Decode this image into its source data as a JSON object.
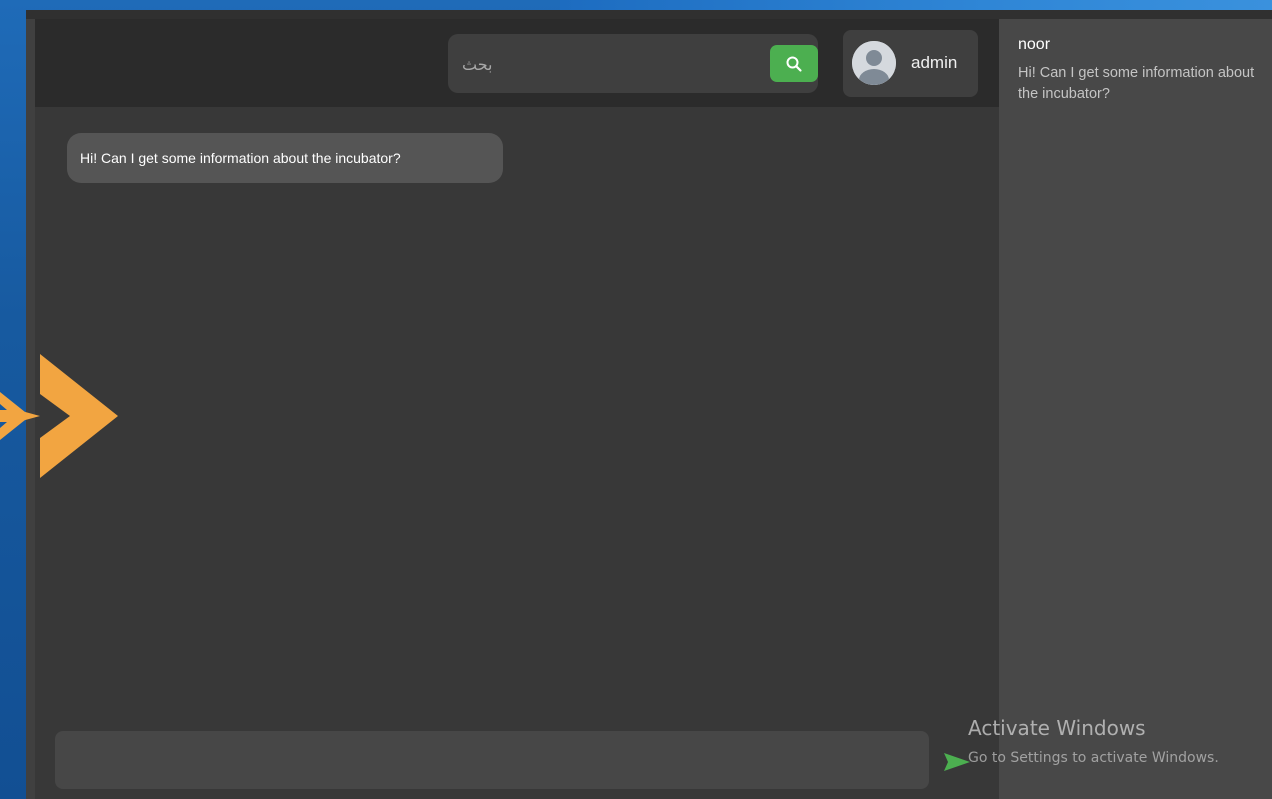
{
  "colors": {
    "desktop": "#175aa0",
    "topbar": "#2b2b2b",
    "chat_background": "#383838",
    "sidebar": "#484848",
    "accent_green": "#4caf50",
    "message_bubble": "#555555",
    "decoration_orange": "#f2a541"
  },
  "header": {
    "search": {
      "placeholder": "بحث",
      "button_icon": "search-icon"
    },
    "user": {
      "avatar_icon": "user-avatar-icon",
      "name": "admin"
    }
  },
  "chat": {
    "messages": [
      {
        "text": "Hi! Can I get some information about the incubator?"
      }
    ],
    "composer": {
      "value": "",
      "send_icon": "send-icon"
    }
  },
  "sidebar": {
    "conversations": [
      {
        "name": "noor",
        "preview": "Hi! Can I get some information about the incubator?"
      }
    ]
  },
  "decoration": {
    "icon": "double-chevron-right-icon"
  },
  "watermark": {
    "title": "Activate Windows",
    "subtitle": "Go to Settings to activate Windows."
  }
}
